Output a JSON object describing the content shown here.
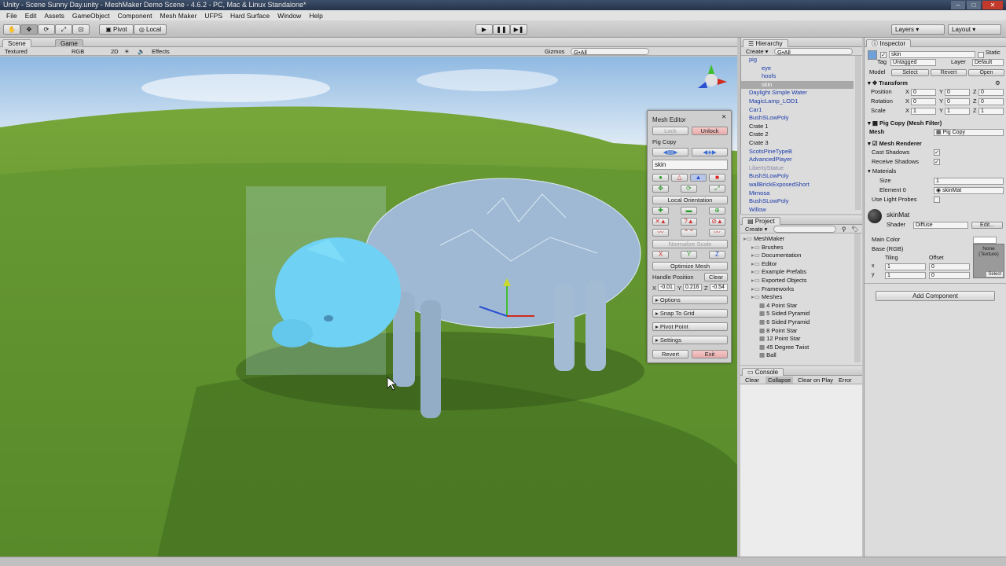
{
  "title": "Unity - Scene Sunny Day.unity - MeshMaker Demo Scene - 4.6.2 - PC, Mac & Linux Standalone*",
  "menu": [
    "File",
    "Edit",
    "Assets",
    "GameObject",
    "Component",
    "Mesh Maker",
    "UFPS",
    "Hard Surface",
    "Window",
    "Help"
  ],
  "toolbar": {
    "pivot": "Pivot",
    "local": "Local",
    "layers": "Layers",
    "layout": "Layout"
  },
  "scene": {
    "tab_scene": "Scene",
    "tab_game": "Game",
    "shading": "Textured",
    "color": "RGB",
    "mode2d": "2D",
    "effects": "Effects",
    "gizmos": "Gizmos",
    "search": "G•All"
  },
  "mesh_editor": {
    "title": "Mesh Editor",
    "lock": "Lock",
    "unlock": "Unlock",
    "object": "Pig Copy",
    "submesh": "skin",
    "local_orientation": "Local Orientation",
    "normalize": "Normalize Scale",
    "x": "X",
    "y": "Y",
    "z": "Z",
    "optimize": "Optimize Mesh",
    "handle_pos": "Handle Position",
    "clear": "Clear",
    "hx": "-0.01",
    "hy": "0.216",
    "hz": "-0.54",
    "options": "Options",
    "snap": "Snap To Grid",
    "pivot": "Pivot Point",
    "settings": "Settings",
    "revert": "Revert",
    "exit": "Exit"
  },
  "hierarchy": {
    "title": "Hierarchy",
    "create": "Create",
    "search": "G•All",
    "items": [
      {
        "label": "pig",
        "indent": 0,
        "color": "blue"
      },
      {
        "label": "eye",
        "indent": 1,
        "color": "blue"
      },
      {
        "label": "hoofs",
        "indent": 1,
        "color": "blue"
      },
      {
        "label": "skin",
        "indent": 1,
        "color": "sel"
      },
      {
        "label": "Daylight Simple Water",
        "indent": 0,
        "color": "blue"
      },
      {
        "label": "MagicLamp_LOD1",
        "indent": 0,
        "color": "blue"
      },
      {
        "label": "Car1",
        "indent": 0,
        "color": "blue"
      },
      {
        "label": "BushSLowPoly",
        "indent": 0,
        "color": "blue"
      },
      {
        "label": "Crate 1",
        "indent": 0,
        "color": "black"
      },
      {
        "label": "Crate 2",
        "indent": 0,
        "color": "black"
      },
      {
        "label": "Crate 3",
        "indent": 0,
        "color": "black"
      },
      {
        "label": "ScotsPineTypeB",
        "indent": 0,
        "color": "blue"
      },
      {
        "label": "AdvancedPlayer",
        "indent": 0,
        "color": "blue"
      },
      {
        "label": "LibertyStatue",
        "indent": 0,
        "color": "grey"
      },
      {
        "label": "BushSLowPoly",
        "indent": 0,
        "color": "blue"
      },
      {
        "label": "wallBrickExposedShort",
        "indent": 0,
        "color": "blue"
      },
      {
        "label": "Mimosa",
        "indent": 0,
        "color": "blue"
      },
      {
        "label": "BushSLowPoly",
        "indent": 0,
        "color": "blue"
      },
      {
        "label": "Willow",
        "indent": 0,
        "color": "blue"
      }
    ]
  },
  "project": {
    "title": "Project",
    "create": "Create",
    "items": [
      {
        "label": "MeshMaker",
        "indent": 0
      },
      {
        "label": "Brushes",
        "indent": 1
      },
      {
        "label": "Documentation",
        "indent": 1
      },
      {
        "label": "Editor",
        "indent": 1
      },
      {
        "label": "Example Prefabs",
        "indent": 1
      },
      {
        "label": "Exported Objects",
        "indent": 1
      },
      {
        "label": "Frameworks",
        "indent": 1
      },
      {
        "label": "Meshes",
        "indent": 1
      },
      {
        "label": "4 Point Star",
        "indent": 2
      },
      {
        "label": "5 Sided Pyramid",
        "indent": 2
      },
      {
        "label": "6 Sided Pyramid",
        "indent": 2
      },
      {
        "label": "8 Point Star",
        "indent": 2
      },
      {
        "label": "12 Point Star",
        "indent": 2
      },
      {
        "label": "45 Degree Twist",
        "indent": 2
      },
      {
        "label": "Ball",
        "indent": 2
      }
    ]
  },
  "console": {
    "title": "Console",
    "clear": "Clear",
    "collapse": "Collapse",
    "clear_on_play": "Clear on Play",
    "error_pause": "Error Pau"
  },
  "inspector": {
    "title": "Inspector",
    "name": "skin",
    "static": "Static",
    "tag_label": "Tag",
    "tag": "Untagged",
    "layer_label": "Layer",
    "layer": "Default",
    "model": "Model",
    "select": "Select",
    "revert": "Revert",
    "open": "Open",
    "transform": "Transform",
    "position": "Position",
    "rotation": "Rotation",
    "scale": "Scale",
    "pos": [
      "0",
      "0",
      "0"
    ],
    "rot": [
      "0",
      "0",
      "0"
    ],
    "scl": [
      "1",
      "1",
      "1"
    ],
    "mesh_filter": "Pig Copy (Mesh Filter)",
    "mesh_label": "Mesh",
    "mesh_value": "Pig Copy",
    "mesh_renderer": "Mesh Renderer",
    "cast": "Cast Shadows",
    "receive": "Receive Shadows",
    "materials": "Materials",
    "size_label": "Size",
    "size": "1",
    "element0": "Element 0",
    "element0_value": "skinMat",
    "light_probes": "Use Light Probes",
    "material_name": "skinMat",
    "shader_label": "Shader",
    "shader": "Diffuse",
    "edit": "Edit...",
    "main_color": "Main Color",
    "base_rgb": "Base (RGB)",
    "tiling": "Tiling",
    "offset": "Offset",
    "tx": "1",
    "ty": "1",
    "ox": "0",
    "oy": "0",
    "none_tex": "None (Texture)",
    "select_tex": "Select",
    "add_component": "Add Component"
  }
}
